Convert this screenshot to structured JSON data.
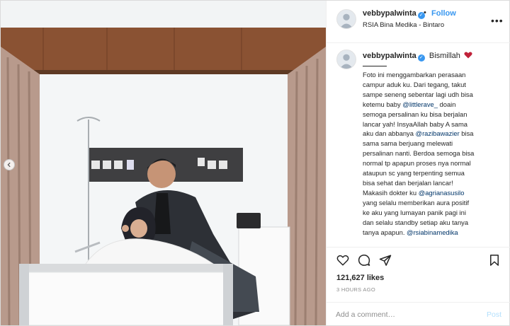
{
  "post": {
    "username": "vebbypalwinta",
    "verified": true,
    "follow_label": "Follow",
    "separator": "•",
    "location": "RSIA Bina Medika - Bintaro",
    "more_label": "•••"
  },
  "caption": {
    "username": "vebbypalwinta",
    "first_word": "Bismillah",
    "lines": [
      [
        {
          "t": "Foto ini menggambarkan perasaan"
        }
      ],
      [
        {
          "t": "campur aduk ku. Dari tegang, takut"
        }
      ],
      [
        {
          "t": "sampe seneng sebentar lagi udh bisa"
        }
      ],
      [
        {
          "t": "ketemu baby "
        },
        {
          "t": "@littlerave_",
          "m": true
        },
        {
          "t": " doain"
        }
      ],
      [
        {
          "t": "semoga persalinan ku bisa berjalan"
        }
      ],
      [
        {
          "t": "lancar yah! InsyaAllah baby A sama"
        }
      ],
      [
        {
          "t": "aku dan abbanya "
        },
        {
          "t": "@razibawazier",
          "m": true
        },
        {
          "t": " bisa"
        }
      ],
      [
        {
          "t": "sama sama berjuang melewati"
        }
      ],
      [
        {
          "t": "persalinan nanti. Berdoa semoga bisa"
        }
      ],
      [
        {
          "t": "normal tp apapun proses nya normal"
        }
      ],
      [
        {
          "t": "ataupun sc yang terpenting semua"
        }
      ],
      [
        {
          "t": "bisa sehat dan berjalan lancar!"
        }
      ],
      [
        {
          "t": "Makasih dokter ku "
        },
        {
          "t": "@agrianasusilo",
          "m": true
        }
      ],
      [
        {
          "t": "yang selalu memberikan aura positif"
        }
      ],
      [
        {
          "t": "ke aku yang lumayan panik pagi ini"
        }
      ],
      [
        {
          "t": "dan selalu standby setiap aku tanya"
        }
      ],
      [
        {
          "t": "tanya apapun. "
        },
        {
          "t": "@rsiabinamedika",
          "m": true
        }
      ]
    ]
  },
  "stats": {
    "likes": "121,627 likes",
    "time_ago": "3 HOURS AGO"
  },
  "comment": {
    "placeholder": "Add a comment…",
    "post_label": "Post"
  },
  "colors": {
    "accent": "#3897f0",
    "mention": "#003569",
    "heart": "#c0223a"
  },
  "icons": [
    "heart-icon",
    "comment-icon",
    "share-icon",
    "bookmark-icon",
    "chevron-left-icon",
    "verified-badge-icon",
    "more-options-icon"
  ]
}
